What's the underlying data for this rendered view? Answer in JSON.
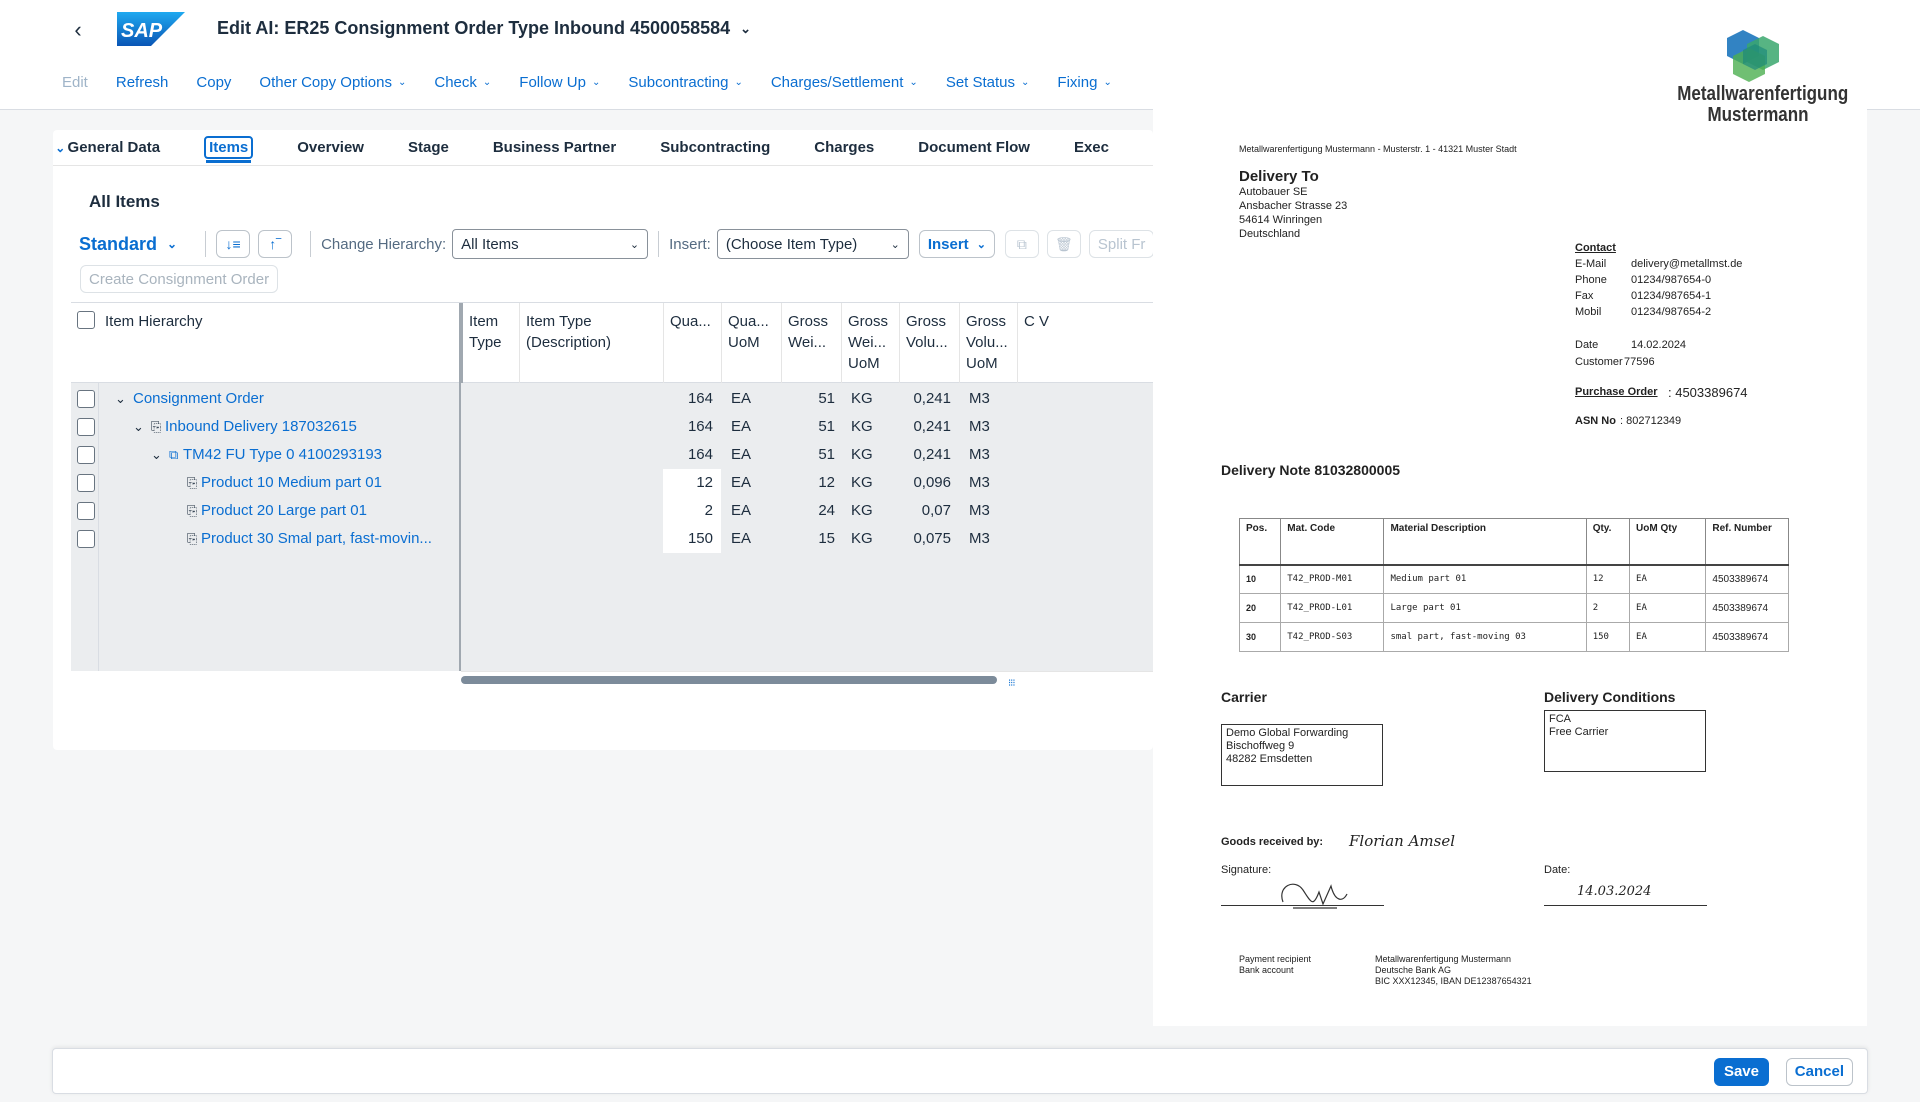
{
  "shell": {
    "logo_text": "SAP",
    "title": "Edit AI: ER25 Consignment Order Type Inbound 4500058584"
  },
  "toolbar": {
    "items": [
      {
        "label": "Edit",
        "enabled": false,
        "menu": false
      },
      {
        "label": "Refresh",
        "enabled": true,
        "menu": false
      },
      {
        "label": "Copy",
        "enabled": true,
        "menu": false
      },
      {
        "label": "Other Copy Options",
        "enabled": true,
        "menu": true
      },
      {
        "label": "Check",
        "enabled": true,
        "menu": true
      },
      {
        "label": "Follow Up",
        "enabled": true,
        "menu": true
      },
      {
        "label": "Subcontracting",
        "enabled": true,
        "menu": true
      },
      {
        "label": "Charges/Settlement",
        "enabled": true,
        "menu": true
      },
      {
        "label": "Set Status",
        "enabled": true,
        "menu": true
      },
      {
        "label": "Fixing",
        "enabled": true,
        "menu": true
      }
    ]
  },
  "tabs": [
    "General Data",
    "Items",
    "Overview",
    "Stage",
    "Business Partner",
    "Subcontracting",
    "Charges",
    "Document Flow",
    "Exec"
  ],
  "active_tab": "Items",
  "section": {
    "title": "All Items",
    "variant": "Standard",
    "change_hierarchy_label": "Change Hierarchy:",
    "change_hierarchy_value": "All Items",
    "insert_label": "Insert:",
    "insert_value": "(Choose Item Type)",
    "insert_button": "Insert",
    "split_button": "Split Fr",
    "create_button": "Create Consignment Order"
  },
  "table": {
    "columns": [
      "Item Hierarchy",
      "Item Type",
      "Item Type (Description)",
      "Qua...",
      "Qua... UoM",
      "Gross Wei...",
      "Gross Wei... UoM",
      "Gross Volu...",
      "Gross Volu... UoM",
      "C V"
    ],
    "rows": [
      {
        "level": 0,
        "expand": "⌄",
        "icon": "",
        "name": "Consignment Order",
        "qty": "164",
        "qty_uom": "EA",
        "weight": "51",
        "weight_uom": "KG",
        "volume": "0,241",
        "volume_uom": "M3",
        "qty_white": false
      },
      {
        "level": 1,
        "expand": "⌄",
        "icon": "delivery-icon",
        "name": "Inbound Delivery 187032615",
        "qty": "164",
        "qty_uom": "EA",
        "weight": "51",
        "weight_uom": "KG",
        "volume": "0,241",
        "volume_uom": "M3",
        "qty_white": false
      },
      {
        "level": 2,
        "expand": "⌄",
        "icon": "freight-unit-icon",
        "name": "TM42 FU Type 0 4100293193",
        "qty": "164",
        "qty_uom": "EA",
        "weight": "51",
        "weight_uom": "KG",
        "volume": "0,241",
        "volume_uom": "M3",
        "qty_white": false
      },
      {
        "level": 3,
        "expand": "",
        "icon": "product-icon",
        "name": "Product 10 Medium part 01",
        "qty": "12",
        "qty_uom": "EA",
        "weight": "12",
        "weight_uom": "KG",
        "volume": "0,096",
        "volume_uom": "M3",
        "qty_white": true
      },
      {
        "level": 3,
        "expand": "",
        "icon": "product-icon",
        "name": "Product 20 Large part 01",
        "qty": "2",
        "qty_uom": "EA",
        "weight": "24",
        "weight_uom": "KG",
        "volume": "0,07",
        "volume_uom": "M3",
        "qty_white": true
      },
      {
        "level": 3,
        "expand": "",
        "icon": "product-icon",
        "name": "Product 30 Smal part, fast-movin...",
        "qty": "150",
        "qty_uom": "EA",
        "weight": "15",
        "weight_uom": "KG",
        "volume": "0,075",
        "volume_uom": "M3",
        "qty_white": true
      }
    ]
  },
  "document": {
    "logo_line1": "Metallwarenfertigung",
    "logo_line2": "Mustermann",
    "sender_line": "Metallwarenfertigung Mustermann - Musterstr. 1 - 41321 Muster Stadt",
    "delivery_to_heading": "Delivery To",
    "address": [
      "Autobauer SE",
      "Ansbacher Strasse 23",
      "54614 Winringen",
      "Deutschland"
    ],
    "contact_heading": "Contact",
    "contact": [
      {
        "label": "E-Mail",
        "value": "delivery@metallmst.de"
      },
      {
        "label": "Phone",
        "value": "01234/987654-0"
      },
      {
        "label": "Fax",
        "value": "01234/987654-1"
      },
      {
        "label": "Mobil",
        "value": "01234/987654-2"
      }
    ],
    "date_label": "Date",
    "date_value": "14.02.2024",
    "customer_label": "Customer",
    "customer_value": "77596",
    "po_label": "Purchase Order",
    "po_value": ": 4503389674",
    "asn_label": "ASN No",
    "asn_value": ": 802712349",
    "delivery_note_title": "Delivery Note 81032800005",
    "dn_columns": [
      "Pos.",
      "Mat. Code",
      "Material Description",
      "Qty.",
      "UoM Qty",
      "Ref. Number"
    ],
    "dn_rows": [
      [
        "10",
        "T42_PROD-M01",
        "Medium part 01",
        "12",
        "EA",
        "4503389674"
      ],
      [
        "20",
        "T42_PROD-L01",
        " Large part 01",
        "2",
        "EA",
        "4503389674"
      ],
      [
        "30",
        "T42_PROD-S03",
        "smal part, fast-moving 03",
        "150",
        "EA",
        "4503389674"
      ]
    ],
    "carrier_heading": "Carrier",
    "carrier": [
      "Demo Global Forwarding",
      "Bischoffweg 9",
      "48282 Emsdetten"
    ],
    "conditions_heading": "Delivery Conditions",
    "conditions": [
      "FCA",
      "Free Carrier"
    ],
    "goods_received_label": "Goods received by:",
    "goods_received_value": "Florian Amsel",
    "signature_label": "Signature:",
    "date2_label": "Date:",
    "date2_value": "14.03.2024",
    "payment_labels": [
      "Payment recipient",
      "Bank account"
    ],
    "payment_values": [
      "Metallwarenfertigung Mustermann",
      "Deutsche Bank AG",
      "BIC XXX12345, IBAN DE12387654321"
    ]
  },
  "footer": {
    "save": "Save",
    "cancel": "Cancel"
  },
  "colors": {
    "accent": "#0a6ed1",
    "logo_blue": "#1c75bc",
    "logo_green": "#3aa76d"
  }
}
